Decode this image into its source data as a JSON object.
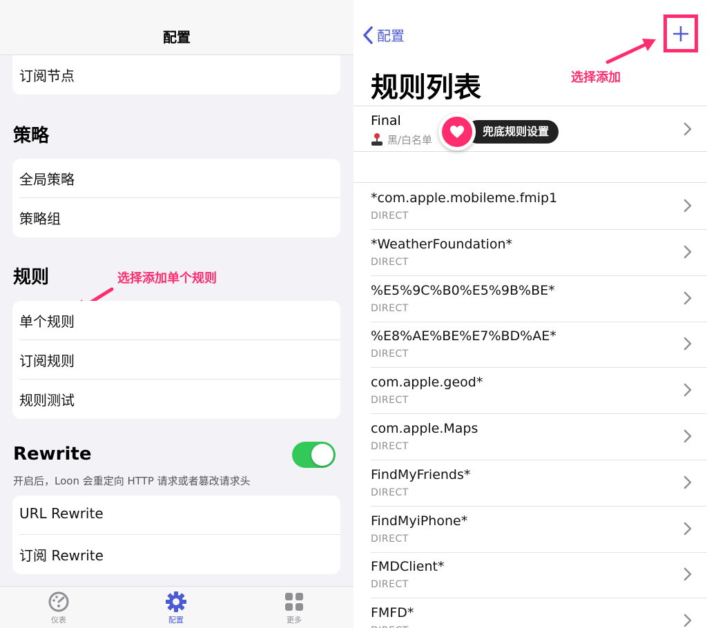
{
  "left": {
    "nav_title": "配置",
    "subscribe_nodes": "订阅节点",
    "policy_section": "策略",
    "policy_items": [
      "全局策略",
      "策略组"
    ],
    "rules_section": "规则",
    "rules_items": [
      "单个规则",
      "订阅规则",
      "规则测试"
    ],
    "rewrite_section": "Rewrite",
    "rewrite_enabled": true,
    "rewrite_desc": "开启后，Loon 会重定向 HTTP 请求或者篡改请求头",
    "rewrite_items": [
      "URL Rewrite",
      "订阅 Rewrite"
    ],
    "annotation": "选择添加单个规则",
    "tabs": [
      {
        "label": "仪表",
        "icon": "dashboard-icon"
      },
      {
        "label": "配置",
        "icon": "gear-icon",
        "active": true
      },
      {
        "label": "更多",
        "icon": "grid-icon"
      }
    ]
  },
  "right": {
    "back_label": "配置",
    "title": "规则列表",
    "annotation": "选择添加",
    "final": {
      "name": "Final",
      "sub": "黑/白名单"
    },
    "badge_text": "兜底规则设置",
    "rules": [
      {
        "name": "*com.apple.mobileme.fmip1",
        "policy": "DIRECT"
      },
      {
        "name": "*WeatherFoundation*",
        "policy": "DIRECT"
      },
      {
        "name": "%E5%9C%B0%E5%9B%BE*",
        "policy": "DIRECT"
      },
      {
        "name": "%E8%AE%BE%E7%BD%AE*",
        "policy": "DIRECT"
      },
      {
        "name": "com.apple.geod*",
        "policy": "DIRECT"
      },
      {
        "name": "com.apple.Maps",
        "policy": "DIRECT"
      },
      {
        "name": "FindMyFriends*",
        "policy": "DIRECT"
      },
      {
        "name": "FindMyiPhone*",
        "policy": "DIRECT"
      },
      {
        "name": "FMDClient*",
        "policy": "DIRECT"
      },
      {
        "name": "FMFD*",
        "policy": "DIRECT"
      }
    ]
  },
  "colors": {
    "accent": "#4c5bd4",
    "annotation": "#ff2d6e",
    "toggle_on": "#34c759"
  }
}
